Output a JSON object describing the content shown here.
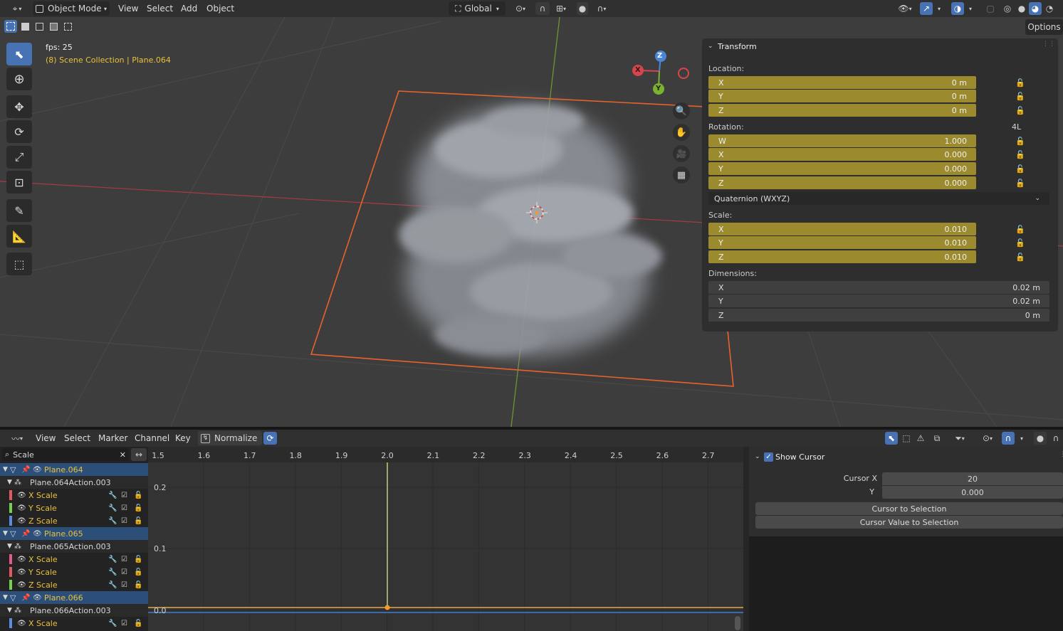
{
  "header": {
    "mode": "Object Mode",
    "menus": [
      "View",
      "Select",
      "Add",
      "Object"
    ],
    "orientation": "Global",
    "options_label": "Options"
  },
  "viewport": {
    "fps_text": "fps: 25",
    "collection_text": "(8) Scene Collection | Plane.064",
    "gizmo": {
      "x": "X",
      "y": "Y",
      "z": "Z"
    }
  },
  "npanel": {
    "title": "Transform",
    "location_label": "Location:",
    "location": [
      {
        "axis": "X",
        "value": "0 m"
      },
      {
        "axis": "Y",
        "value": "0 m"
      },
      {
        "axis": "Z",
        "value": "0 m"
      }
    ],
    "rotation_label": "Rotation:",
    "rotation_mode_badge": "4L",
    "rotation": [
      {
        "axis": "W",
        "value": "1.000"
      },
      {
        "axis": "X",
        "value": "0.000"
      },
      {
        "axis": "Y",
        "value": "0.000"
      },
      {
        "axis": "Z",
        "value": "0.000"
      }
    ],
    "rotation_mode": "Quaternion (WXYZ)",
    "scale_label": "Scale:",
    "scale": [
      {
        "axis": "X",
        "value": "0.010"
      },
      {
        "axis": "Y",
        "value": "0.010"
      },
      {
        "axis": "Z",
        "value": "0.010"
      }
    ],
    "dimensions_label": "Dimensions:",
    "dimensions": [
      {
        "axis": "X",
        "value": "0.02 m"
      },
      {
        "axis": "Y",
        "value": "0.02 m"
      },
      {
        "axis": "Z",
        "value": "0 m"
      }
    ]
  },
  "graph_editor": {
    "menus": [
      "View",
      "Select",
      "Marker",
      "Channel",
      "Key"
    ],
    "normalize_label": "Normalize",
    "search_value": "Scale",
    "frame_ticks": [
      "1.5",
      "1.6",
      "1.7",
      "1.8",
      "1.9",
      "2.0",
      "2.1",
      "2.2",
      "2.3",
      "2.4",
      "2.5",
      "2.6",
      "2.7"
    ],
    "value_ticks": [
      "0.2",
      "0.1",
      "0.0"
    ],
    "channels": [
      {
        "type": "object",
        "label": "Plane.064"
      },
      {
        "type": "action",
        "label": "Plane.064Action.003"
      },
      {
        "type": "fcurve",
        "label": "X Scale",
        "color": "#e2595f"
      },
      {
        "type": "fcurve",
        "label": "Y Scale",
        "color": "#74d34b"
      },
      {
        "type": "fcurve",
        "label": "Z Scale",
        "color": "#5b8be3"
      },
      {
        "type": "object",
        "label": "Plane.065"
      },
      {
        "type": "action",
        "label": "Plane.065Action.003"
      },
      {
        "type": "fcurve",
        "label": "X Scale",
        "color": "#e55a8d"
      },
      {
        "type": "fcurve",
        "label": "Y Scale",
        "color": "#e2595f"
      },
      {
        "type": "fcurve",
        "label": "Z Scale",
        "color": "#74d34b"
      },
      {
        "type": "object",
        "label": "Plane.066"
      },
      {
        "type": "action",
        "label": "Plane.066Action.003"
      },
      {
        "type": "fcurve",
        "label": "X Scale",
        "color": "#5b8be3"
      }
    ],
    "sidebar": {
      "show_cursor_label": "Show Cursor",
      "cursor_x_label": "Cursor X",
      "cursor_x_value": "20",
      "cursor_y_label": "Y",
      "cursor_y_value": "0.000",
      "cursor_to_selection": "Cursor to Selection",
      "cursor_value_to_selection": "Cursor Value to Selection"
    }
  },
  "colors": {
    "accent": "#4772b3",
    "field_animated": "#9c8a2e",
    "selection_orange": "#e8622d",
    "text_yellow": "#e7c23f"
  }
}
